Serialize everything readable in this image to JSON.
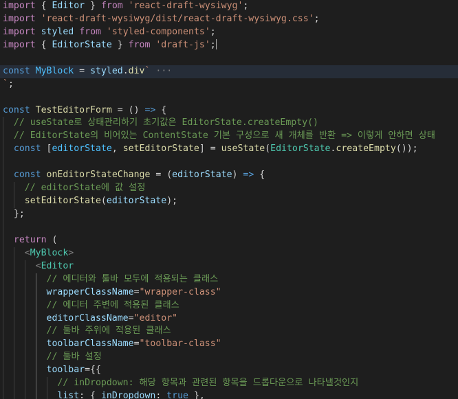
{
  "colors": {
    "background": "#1e1e1e",
    "current_line": "#262d38",
    "keyword": "#569cd6",
    "control_keyword": "#c586c0",
    "string": "#ce9178",
    "function": "#dcdcaa",
    "variable": "#9cdcfe",
    "constant": "#4fc1ff",
    "component": "#4ec9b0",
    "comment": "#6a9955",
    "punctuation": "#d4d4d4"
  },
  "code": {
    "lines": [
      [
        [
          "kwc",
          "import"
        ],
        [
          "pun",
          " { "
        ],
        [
          "var",
          "Editor"
        ],
        [
          "pun",
          " } "
        ],
        [
          "kwc",
          "from"
        ],
        [
          "pun",
          " "
        ],
        [
          "str",
          "'react-draft-wysiwyg'"
        ],
        [
          "pun",
          ";"
        ]
      ],
      [
        [
          "kwc",
          "import"
        ],
        [
          "pun",
          " "
        ],
        [
          "str",
          "'react-draft-wysiwyg/dist/react-draft-wysiwyg.css'"
        ],
        [
          "pun",
          ";"
        ]
      ],
      [
        [
          "kwc",
          "import"
        ],
        [
          "pun",
          " "
        ],
        [
          "var",
          "styled"
        ],
        [
          "pun",
          " "
        ],
        [
          "kwc",
          "from"
        ],
        [
          "pun",
          " "
        ],
        [
          "str",
          "'styled-components'"
        ],
        [
          "pun",
          ";"
        ]
      ],
      [
        [
          "kwc",
          "import"
        ],
        [
          "pun",
          " { "
        ],
        [
          "var",
          "EditorState"
        ],
        [
          "pun",
          " } "
        ],
        [
          "kwc",
          "from"
        ],
        [
          "pun",
          " "
        ],
        [
          "str",
          "'draft-js'"
        ],
        [
          "pun",
          ";"
        ]
      ],
      [],
      [
        [
          "kw",
          "const"
        ],
        [
          "pun",
          " "
        ],
        [
          "cst",
          "MyBlock"
        ],
        [
          "pun",
          " = "
        ],
        [
          "var",
          "styled"
        ],
        [
          "pun",
          "."
        ],
        [
          "fn",
          "div"
        ],
        [
          "str",
          "`"
        ],
        [
          "fold",
          " ···"
        ]
      ],
      [
        [
          "str",
          "`"
        ],
        [
          "pun",
          ";"
        ]
      ],
      [],
      [
        [
          "kw",
          "const"
        ],
        [
          "pun",
          " "
        ],
        [
          "fn",
          "TestEditorForm"
        ],
        [
          "pun",
          " = () "
        ],
        [
          "kw",
          "=>"
        ],
        [
          "pun",
          " {"
        ]
      ],
      [
        [
          "pun",
          "  "
        ],
        [
          "cmt",
          "// useState로 상태관리하기 초기값은 EditorState.createEmpty()"
        ]
      ],
      [
        [
          "pun",
          "  "
        ],
        [
          "cmt",
          "// EditorState의 비어있는 ContentState 기본 구성으로 새 개체를 반환 => 이렇게 안하면 상태"
        ]
      ],
      [
        [
          "pun",
          "  "
        ],
        [
          "kw",
          "const"
        ],
        [
          "pun",
          " ["
        ],
        [
          "cst",
          "editorState"
        ],
        [
          "pun",
          ", "
        ],
        [
          "fn",
          "setEditorState"
        ],
        [
          "pun",
          "] = "
        ],
        [
          "fn",
          "useState"
        ],
        [
          "pun",
          "("
        ],
        [
          "cls",
          "EditorState"
        ],
        [
          "pun",
          "."
        ],
        [
          "fn",
          "createEmpty"
        ],
        [
          "pun",
          "());"
        ]
      ],
      [],
      [
        [
          "pun",
          "  "
        ],
        [
          "kw",
          "const"
        ],
        [
          "pun",
          " "
        ],
        [
          "fn",
          "onEditorStateChange"
        ],
        [
          "pun",
          " = ("
        ],
        [
          "var",
          "editorState"
        ],
        [
          "pun",
          ") "
        ],
        [
          "kw",
          "=>"
        ],
        [
          "pun",
          " {"
        ]
      ],
      [
        [
          "pun",
          "    "
        ],
        [
          "cmt",
          "// editorState에 값 설정"
        ]
      ],
      [
        [
          "pun",
          "    "
        ],
        [
          "fn",
          "setEditorState"
        ],
        [
          "pun",
          "("
        ],
        [
          "var",
          "editorState"
        ],
        [
          "pun",
          ");"
        ]
      ],
      [
        [
          "pun",
          "  };"
        ]
      ],
      [],
      [
        [
          "pun",
          "  "
        ],
        [
          "kwc",
          "return"
        ],
        [
          "pun",
          " ("
        ]
      ],
      [
        [
          "pun",
          "    "
        ],
        [
          "tag",
          "<"
        ],
        [
          "cls",
          "MyBlock"
        ],
        [
          "tag",
          ">"
        ]
      ],
      [
        [
          "pun",
          "      "
        ],
        [
          "tag",
          "<"
        ],
        [
          "cls",
          "Editor"
        ]
      ],
      [
        [
          "pun",
          "        "
        ],
        [
          "cmt",
          "// 에디터와 툴바 모두에 적용되는 클래스"
        ]
      ],
      [
        [
          "pun",
          "        "
        ],
        [
          "var",
          "wrapperClassName"
        ],
        [
          "pun",
          "="
        ],
        [
          "str",
          "\"wrapper-class\""
        ]
      ],
      [
        [
          "pun",
          "        "
        ],
        [
          "cmt",
          "// 에디터 주변에 적용된 클래스"
        ]
      ],
      [
        [
          "pun",
          "        "
        ],
        [
          "var",
          "editorClassName"
        ],
        [
          "pun",
          "="
        ],
        [
          "str",
          "\"editor\""
        ]
      ],
      [
        [
          "pun",
          "        "
        ],
        [
          "cmt",
          "// 툴바 주위에 적용된 클래스"
        ]
      ],
      [
        [
          "pun",
          "        "
        ],
        [
          "var",
          "toolbarClassName"
        ],
        [
          "pun",
          "="
        ],
        [
          "str",
          "\"toolbar-class\""
        ]
      ],
      [
        [
          "pun",
          "        "
        ],
        [
          "cmt",
          "// 툴바 설정"
        ]
      ],
      [
        [
          "pun",
          "        "
        ],
        [
          "var",
          "toolbar"
        ],
        [
          "pun",
          "={{"
        ]
      ],
      [
        [
          "pun",
          "          "
        ],
        [
          "cmt",
          "// inDropdown: 해당 항목과 관련된 항목을 드롭다운으로 나타낼것인지"
        ]
      ],
      [
        [
          "pun",
          "          "
        ],
        [
          "var",
          "list"
        ],
        [
          "pun",
          ": { "
        ],
        [
          "var",
          "inDropdown"
        ],
        [
          "pun",
          ": "
        ],
        [
          "kw",
          "true"
        ],
        [
          "pun",
          " },"
        ]
      ]
    ]
  }
}
